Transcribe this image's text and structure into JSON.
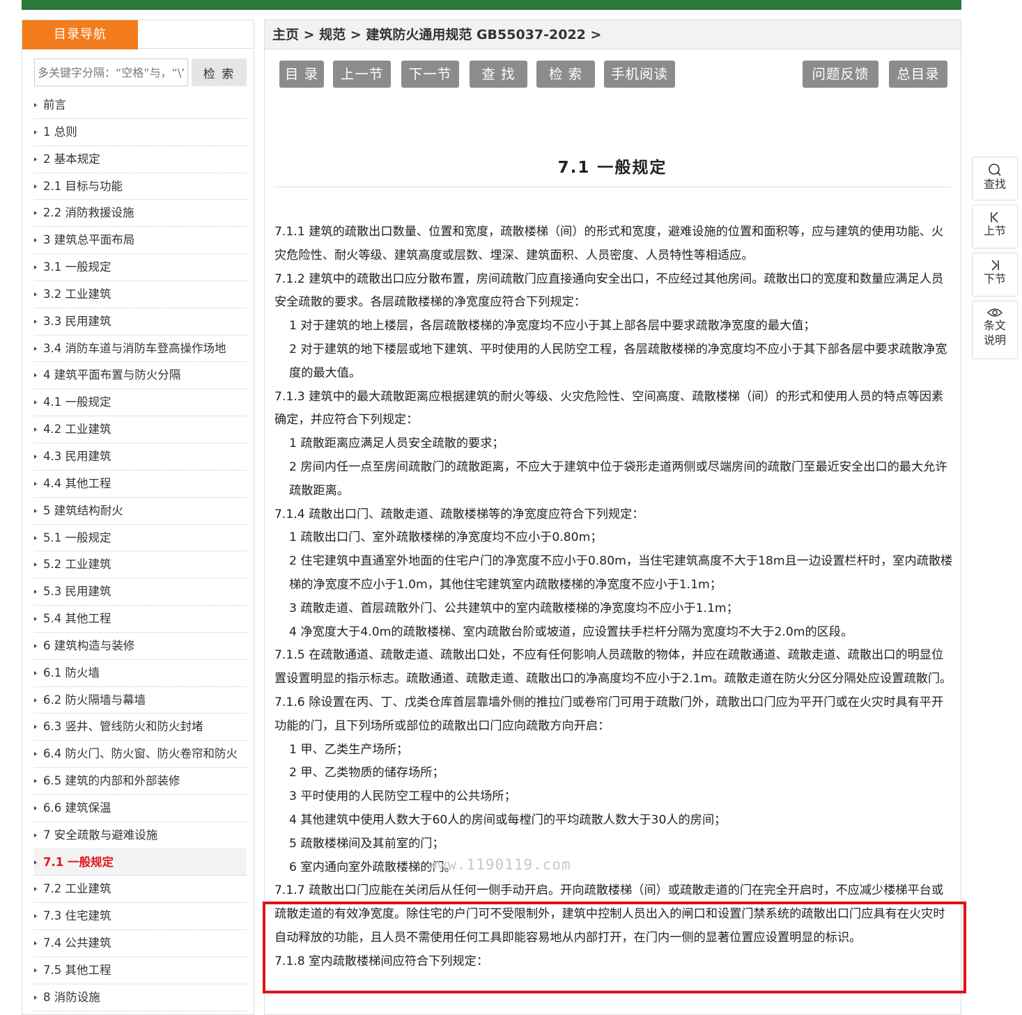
{
  "sidebar": {
    "tab_label": "目录导航",
    "search_placeholder": "多关键字分隔：“空格”与，“\\”或",
    "search_button": "检 索",
    "items": [
      "前言",
      "1 总则",
      "2 基本规定",
      "2.1 目标与功能",
      "2.2 消防救援设施",
      "3 建筑总平面布局",
      "3.1 一般规定",
      "3.2 工业建筑",
      "3.3 民用建筑",
      "3.4 消防车道与消防车登高操作场地",
      "4 建筑平面布置与防火分隔",
      "4.1 一般规定",
      "4.2 工业建筑",
      "4.3 民用建筑",
      "4.4 其他工程",
      "5 建筑结构耐火",
      "5.1 一般规定",
      "5.2 工业建筑",
      "5.3 民用建筑",
      "5.4 其他工程",
      "6 建筑构造与装修",
      "6.1 防火墙",
      "6.2 防火隔墙与幕墙",
      "6.3 竖井、管线防火和防火封堵",
      "6.4 防火门、防火窗、防火卷帘和防火",
      "6.5 建筑的内部和外部装修",
      "6.6 建筑保温",
      "7 安全疏散与避难设施",
      "7.1 一般规定",
      "7.2 工业建筑",
      "7.3 住宅建筑",
      "7.4 公共建筑",
      "7.5 其他工程",
      "8 消防设施"
    ],
    "active_index": 28
  },
  "breadcrumb": {
    "home": "主页",
    "sep": " > ",
    "section": "规范",
    "doc": "建筑防火通用规范 GB55037-2022",
    "tail": " >"
  },
  "toolbar": {
    "toc": "目 录",
    "prev": "上一节",
    "next": "下一节",
    "find": "查 找",
    "search": "检 索",
    "mobile": "手机阅读",
    "feedback": "问题反馈",
    "all_toc": "总目录"
  },
  "article": {
    "title": "7.1 一般规定",
    "paragraphs": [
      {
        "indent": false,
        "text": "7.1.1 建筑的疏散出口数量、位置和宽度，疏散楼梯（间）的形式和宽度，避难设施的位置和面积等，应与建筑的使用功能、火灾危险性、耐火等级、建筑高度或层数、埋深、建筑面积、人员密度、人员特性等相适应。"
      },
      {
        "indent": false,
        "text": "7.1.2 建筑中的疏散出口应分散布置，房间疏散门应直接通向安全出口，不应经过其他房间。疏散出口的宽度和数量应满足人员安全疏散的要求。各层疏散楼梯的净宽度应符合下列规定："
      },
      {
        "indent": true,
        "text": "1 对于建筑的地上楼层，各层疏散楼梯的净宽度均不应小于其上部各层中要求疏散净宽度的最大值；"
      },
      {
        "indent": true,
        "text": "2 对于建筑的地下楼层或地下建筑、平时使用的人民防空工程，各层疏散楼梯的净宽度均不应小于其下部各层中要求疏散净宽度的最大值。"
      },
      {
        "indent": false,
        "text": "7.1.3 建筑中的最大疏散距离应根据建筑的耐火等级、火灾危险性、空间高度、疏散楼梯（间）的形式和使用人员的特点等因素确定，并应符合下列规定："
      },
      {
        "indent": true,
        "text": "1 疏散距离应满足人员安全疏散的要求；"
      },
      {
        "indent": true,
        "text": "2 房间内任一点至房间疏散门的疏散距离，不应大于建筑中位于袋形走道两侧或尽端房间的疏散门至最近安全出口的最大允许疏散距离。"
      },
      {
        "indent": false,
        "text": "7.1.4 疏散出口门、疏散走道、疏散楼梯等的净宽度应符合下列规定："
      },
      {
        "indent": true,
        "text": "1 疏散出口门、室外疏散楼梯的净宽度均不应小于0.80m；"
      },
      {
        "indent": true,
        "text": "2 住宅建筑中直通室外地面的住宅户门的净宽度不应小于0.80m，当住宅建筑高度不大于18m且一边设置栏杆时，室内疏散楼梯的净宽度不应小于1.0m，其他住宅建筑室内疏散楼梯的净宽度不应小于1.1m；"
      },
      {
        "indent": true,
        "text": "3 疏散走道、首层疏散外门、公共建筑中的室内疏散楼梯的净宽度均不应小于1.1m；"
      },
      {
        "indent": true,
        "text": "4 净宽度大于4.0m的疏散楼梯、室内疏散台阶或坡道，应设置扶手栏杆分隔为宽度均不大于2.0m的区段。"
      },
      {
        "indent": false,
        "text": "7.1.5 在疏散通道、疏散走道、疏散出口处，不应有任何影响人员疏散的物体，并应在疏散通道、疏散走道、疏散出口的明显位置设置明显的指示标志。疏散通道、疏散走道、疏散出口的净高度均不应小于2.1m。疏散走道在防火分区分隔处应设置疏散门。"
      },
      {
        "indent": false,
        "text": "7.1.6 除设置在丙、丁、戊类仓库首层靠墙外侧的推拉门或卷帘门可用于疏散门外，疏散出口门应为平开门或在火灾时具有平开功能的门，且下列场所或部位的疏散出口门应向疏散方向开启："
      },
      {
        "indent": true,
        "text": "1 甲、乙类生产场所；"
      },
      {
        "indent": true,
        "text": "2 甲、乙类物质的储存场所；"
      },
      {
        "indent": true,
        "text": "3 平时使用的人民防空工程中的公共场所；"
      },
      {
        "indent": true,
        "text": "4 其他建筑中使用人数大于60人的房间或每樘门的平均疏散人数大于30人的房间；"
      },
      {
        "indent": true,
        "text": "5 疏散楼梯间及其前室的门；"
      },
      {
        "indent": true,
        "text": "6 室内通向室外疏散楼梯的门。"
      },
      {
        "indent": false,
        "text": "7.1.7 疏散出口门应能在关闭后从任何一侧手动开启。开向疏散楼梯（间）或疏散走道的门在完全开启时，不应减少楼梯平台或疏散走道的有效净宽度。除住宅的户门可不受限制外，建筑中控制人员出入的闸口和设置门禁系统的疏散出口门应具有在火灾时自动释放的功能，且人员不需使用任何工具即能容易地从内部打开，在门内一侧的显著位置应设置明显的标识。"
      },
      {
        "indent": false,
        "text": "7.1.8 室内疏散楼梯间应符合下列规定："
      }
    ],
    "watermark": "www.1190119.com",
    "highlight_color": "#e0121a"
  },
  "right_tools": {
    "find": "查找",
    "prev": "上节",
    "next": "下节",
    "explain_line1": "条文",
    "explain_line2": "说明"
  },
  "colors": {
    "nav_green": "#2a7a3b",
    "tab_orange": "#f37c1c",
    "button_gray": "#8c8c8c",
    "active_red": "#e3151b"
  }
}
